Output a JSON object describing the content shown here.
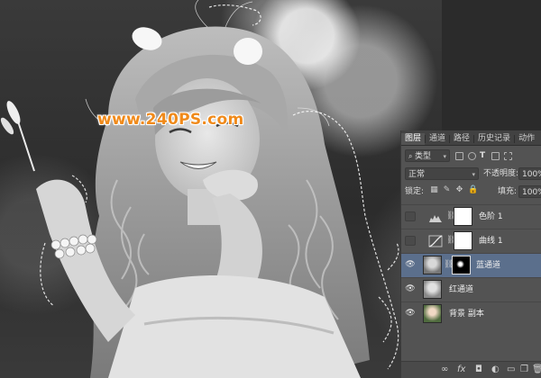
{
  "watermark": "www.240PS.com",
  "panel": {
    "tabs": [
      "图层",
      "通道",
      "路径",
      "历史记录",
      "动作"
    ],
    "active_tab": "图层",
    "filter_kind": "类型",
    "blend_mode": "正常",
    "opacity_label": "不透明度:",
    "opacity_value": "100%",
    "lock_label": "锁定:",
    "fill_label": "填充:",
    "fill_value": "100%",
    "layers": [
      {
        "name": "色阶 1",
        "visible": false,
        "type": "levels"
      },
      {
        "name": "曲线 1",
        "visible": false,
        "type": "curves"
      },
      {
        "name": "蓝通道",
        "visible": true,
        "type": "masked",
        "selected": true
      },
      {
        "name": "红通道",
        "visible": true,
        "type": "image"
      },
      {
        "name": "背景 副本",
        "visible": true,
        "type": "image"
      }
    ],
    "footer_icons": [
      "link-icon",
      "fx-icon",
      "mask-icon",
      "adjustment-icon",
      "folder-icon",
      "new-layer-icon",
      "trash-icon"
    ]
  },
  "colors": {
    "selected_layer": "#5b6f8c",
    "panel_bg": "#535353",
    "watermark": "#f08a1a"
  }
}
